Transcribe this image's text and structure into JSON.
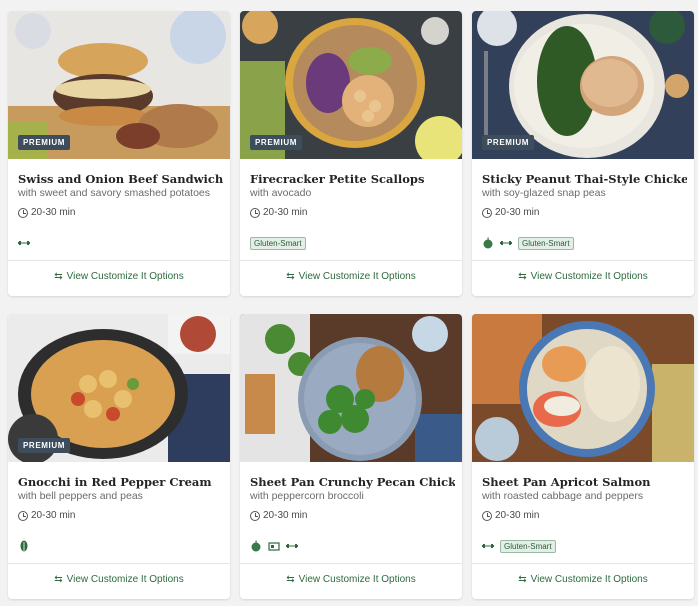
{
  "cards": [
    {
      "title": "Swiss and Onion Beef Sandwich",
      "subtitle": "with sweet and savory smashed potatoes",
      "time": "20-30 min",
      "badge": "PREMIUM",
      "icons": [
        "protein-icon"
      ],
      "chips": [],
      "customize": "View Customize It Options"
    },
    {
      "title": "Firecracker Petite Scallops",
      "subtitle": "with avocado",
      "time": "20-30 min",
      "badge": "PREMIUM",
      "icons": [],
      "chips": [
        "Gluten-Smart"
      ],
      "customize": "View Customize It Options"
    },
    {
      "title": "Sticky Peanut Thai-Style Chicken",
      "subtitle": "with soy-glazed snap peas",
      "time": "20-30 min",
      "badge": "PREMIUM",
      "icons": [
        "apple-icon",
        "protein-icon"
      ],
      "chips": [
        "Gluten-Smart"
      ],
      "customize": "View Customize It Options"
    },
    {
      "title": "Gnocchi in Red Pepper Cream",
      "subtitle": "with bell peppers and peas",
      "time": "20-30 min",
      "badge": "PREMIUM",
      "icons": [
        "leaf-icon"
      ],
      "chips": [],
      "customize": "View Customize It Options"
    },
    {
      "title": "Sheet Pan Crunchy Pecan Chicken",
      "subtitle": "with peppercorn broccoli",
      "time": "20-30 min",
      "badge": "",
      "icons": [
        "apple-icon",
        "sheet-pan-icon",
        "protein-icon"
      ],
      "chips": [],
      "customize": "View Customize It Options"
    },
    {
      "title": "Sheet Pan Apricot Salmon",
      "subtitle": "with roasted cabbage and peppers",
      "time": "20-30 min",
      "badge": "",
      "icons": [
        "protein-icon"
      ],
      "chips": [
        "Gluten-Smart"
      ],
      "customize": "View Customize It Options"
    }
  ],
  "colors": {
    "accent_green": "#2f6b3f",
    "badge_bg": "#3d4d5c",
    "chip_bg": "#e3efe6"
  }
}
